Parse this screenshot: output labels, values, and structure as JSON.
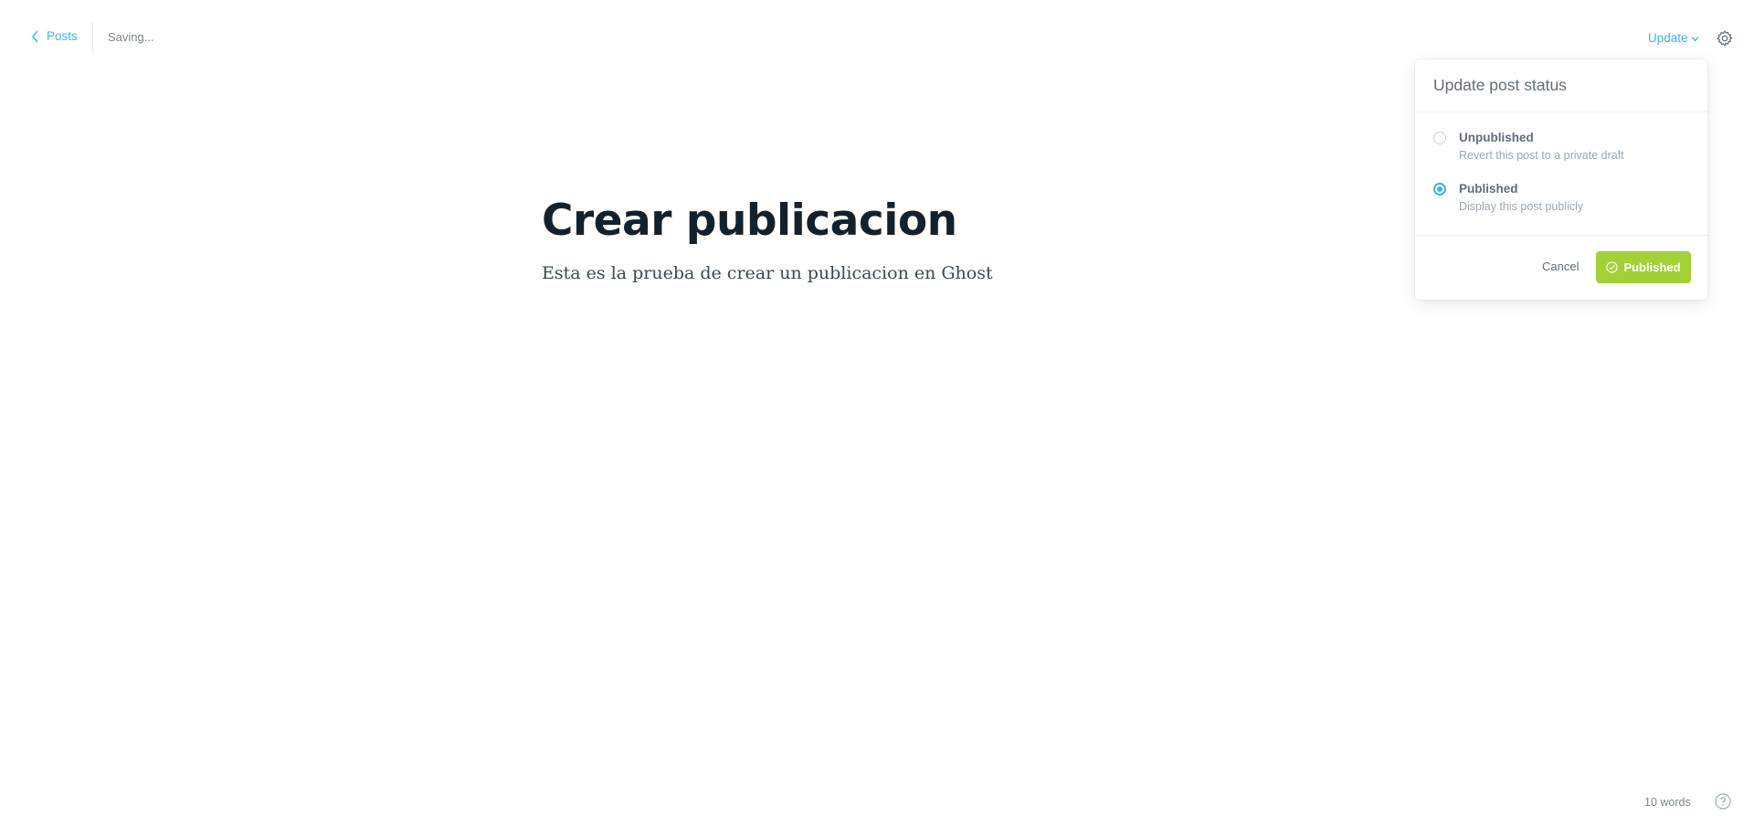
{
  "header": {
    "back_label": "Posts",
    "status_text": "Saving...",
    "update_label": "Update"
  },
  "post": {
    "title": "Crear publicacion",
    "body": "Esta es la prueba de crear un publicacion en Ghost"
  },
  "status_popover": {
    "title": "Update post status",
    "options": [
      {
        "label": "Unpublished",
        "description": "Revert this post to a private draft",
        "selected": false
      },
      {
        "label": "Published",
        "description": "Display this post publicly",
        "selected": true
      }
    ],
    "cancel_label": "Cancel",
    "confirm_label": "Published"
  },
  "footer": {
    "word_count": "10 words"
  },
  "colors": {
    "accent": "#3eb0ef",
    "success": "#a4d037",
    "text": "#15212a"
  },
  "icons": [
    "chevron-left-icon",
    "chevron-down-icon",
    "gear-icon",
    "check-circle-icon",
    "help-icon"
  ]
}
